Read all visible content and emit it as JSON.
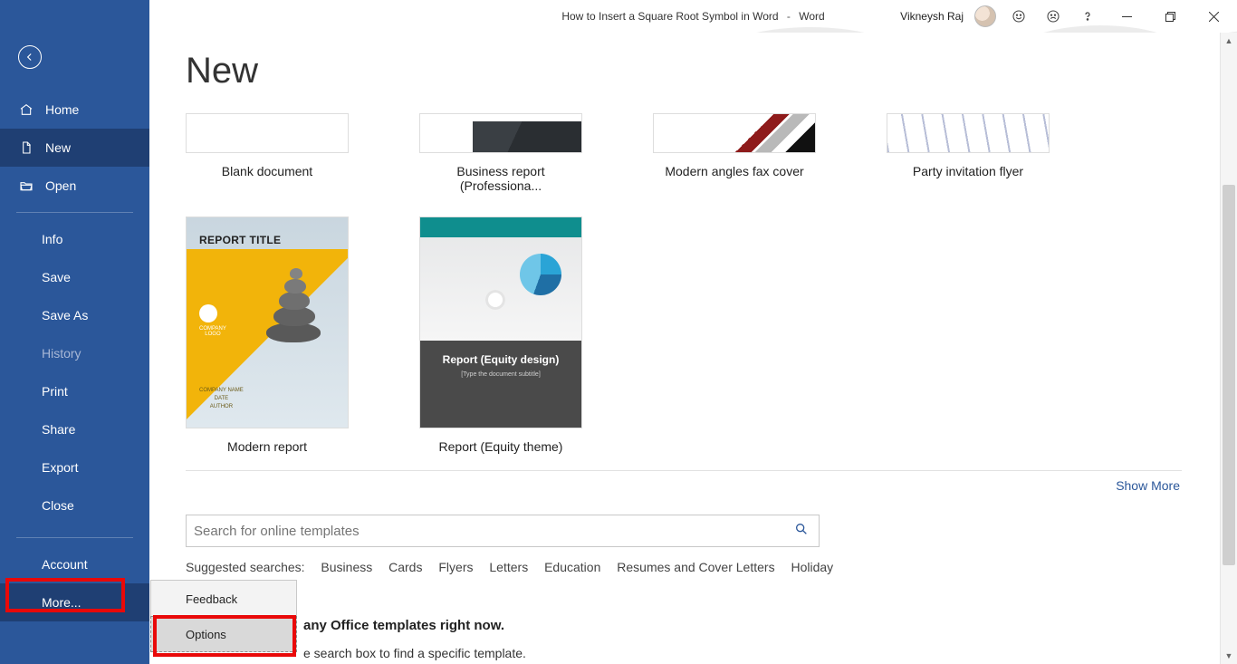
{
  "titlebar": {
    "doc_title": "How to Insert a Square Root Symbol in Word",
    "sep": "-",
    "app_name": "Word",
    "user": "Vikneysh Raj"
  },
  "sidebar": {
    "home": "Home",
    "new": "New",
    "open": "Open",
    "info": "Info",
    "save": "Save",
    "save_as": "Save As",
    "history": "History",
    "print": "Print",
    "share": "Share",
    "export": "Export",
    "close": "Close",
    "account": "Account",
    "more": "More..."
  },
  "flyout": {
    "feedback": "Feedback",
    "options": "Options"
  },
  "main": {
    "page_title": "New",
    "templates_row1": [
      {
        "label": "Blank document"
      },
      {
        "label": "Business report (Professiona..."
      },
      {
        "label": "Modern angles fax cover"
      },
      {
        "label": "Party invitation flyer"
      }
    ],
    "templates_row2": [
      {
        "label": "Modern report",
        "thumb": {
          "title": "REPORT TITLE",
          "sub": "COMPANY\nLOGO",
          "meta": "COMPANY NAME\nDATE\nAUTHOR"
        }
      },
      {
        "label": "Report (Equity theme)",
        "thumb": {
          "h": "Report (Equity design)",
          "s": "[Type the document subtitle]"
        }
      }
    ],
    "show_more": "Show More",
    "search_placeholder": "Search for online templates",
    "suggested_label": "Suggested searches:",
    "suggested": [
      "Business",
      "Cards",
      "Flyers",
      "Letters",
      "Education",
      "Resumes and Cover Letters",
      "Holiday"
    ],
    "note_bold": "any Office templates right now.",
    "note_desc": "e search box to find a specific template."
  }
}
